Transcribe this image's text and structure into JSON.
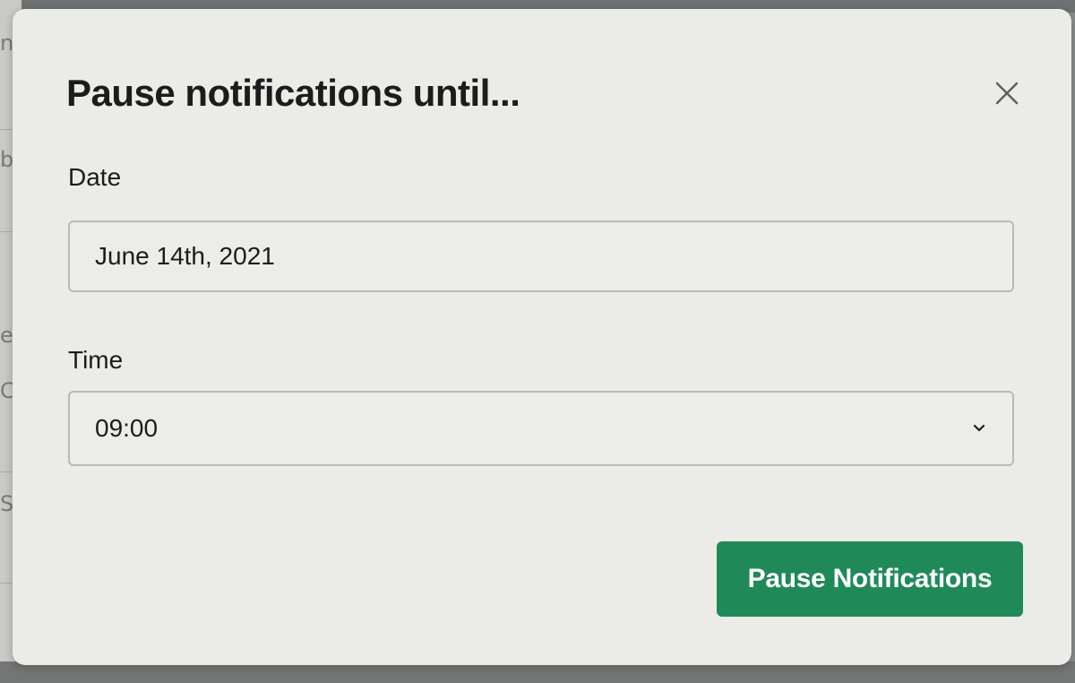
{
  "modal": {
    "title": "Pause notifications until...",
    "close_icon": "close-icon",
    "date": {
      "label": "Date",
      "value": "June 14th, 2021"
    },
    "time": {
      "label": "Time",
      "value": "09:00",
      "chevron_icon": "chevron-down-icon"
    },
    "primary_button": {
      "label": "Pause Notifications",
      "color": "#1f8a58"
    }
  }
}
